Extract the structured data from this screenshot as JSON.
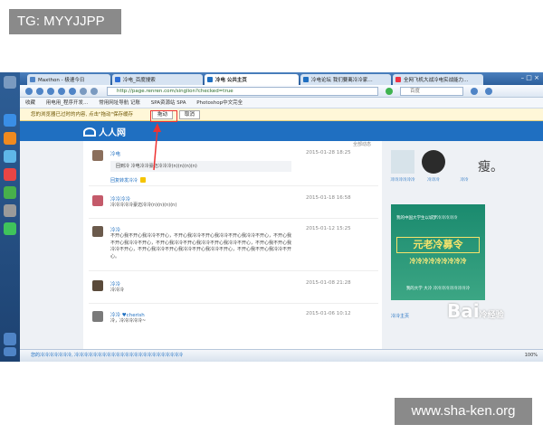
{
  "overlay": {
    "tag": "TG: MYYJJPP",
    "watermark": "www.sha-ken.org"
  },
  "browser": {
    "tabs": [
      {
        "label": "Maxthon - 极速今日",
        "active": false
      },
      {
        "label": "冷电_百度搜索",
        "active": false
      },
      {
        "label": "冷电 公共主页",
        "active": true
      },
      {
        "label": "冷电论坛 我们要离冷冷家…",
        "active": false
      },
      {
        "label": "全网飞机大战冷电实战能力…",
        "active": false
      }
    ],
    "window_controls": "– □ ×",
    "address": "http://page.renren.com/singlion?checked=true",
    "search_placeholder": "百度",
    "favorites": [
      "收藏",
      "用电用_程序开发…",
      "常用网址导航 记账",
      "SPA资源站 SPA",
      "Photoshop中文完全"
    ],
    "notify": {
      "text": "您的浏览器已过时的内容, 点击\"拖动\"保存缓存",
      "allow": "拖动",
      "cancel": "取消"
    }
  },
  "site": {
    "logo": "人人网"
  },
  "feed": {
    "header_right": "全部动态",
    "posts": [
      {
        "name": "冷电",
        "time": "2015-01-28 18:25",
        "quote": "回到冷 冷电冷冷豪迈冷冷冷(n)(n)(n)(n)",
        "share": "回复转发冷冷"
      },
      {
        "name": "冷冷冷冷",
        "time": "2015-01-18 16:58",
        "body": "冷冷冷冷冷豪迈冷冷(n)(n)(n)(n)"
      },
      {
        "name": "冷冷",
        "time": "2015-01-12 15:25",
        "body": "不开心我不开心我冷冷不开心，不开心我冷冷不开心我冷冷不开心我冷冷不开心，不开心我不开心我冷冷不开心，不开心我冷冷不开心我冷冷不开心我冷冷不开心，不开心我不开心我冷冷不开心，不开心我冷冷不开心我冷冷不开心我冷冷不开心，不开心我不开心我冷冷不开心。"
      },
      {
        "name": "冷冷",
        "time": "2015-01-08 21:28",
        "body": "冷冷冷"
      },
      {
        "name": "冷冷 ♥cherish",
        "time": "2015-01-06 10:12",
        "body": "冷，冷冷冷冷冷~"
      }
    ]
  },
  "sidebar": {
    "avatars": [
      {
        "caption": "冷冷冷冷冷冷"
      },
      {
        "caption": "冷冷冷"
      },
      {
        "caption": "冷冷"
      }
    ],
    "title": "瘦。",
    "ad": {
      "line1": "我的中国大学生以城梦冷冷冷冷冷",
      "big": "元老冷募令",
      "line2": "冷冷冷冷冷冷冷冷冷",
      "line3": "我的大学 大冷 冷冷冷冷冷冷冷冷冷"
    },
    "footer": "冷冷主页",
    "baidu": "Bai",
    "baidu_small": "冷经验"
  },
  "statusbar": {
    "left": "您的冷冷冷冷冷冷冷, 冷冷冷冷冷冷冷冷冷冷冷冷冷冷冷冷冷冷冷冷冷冷冷冷",
    "right": "100%"
  },
  "colors": {
    "header": "#1f6fc1",
    "window_frame": "#2d5f9c",
    "highlight": "#e33"
  }
}
